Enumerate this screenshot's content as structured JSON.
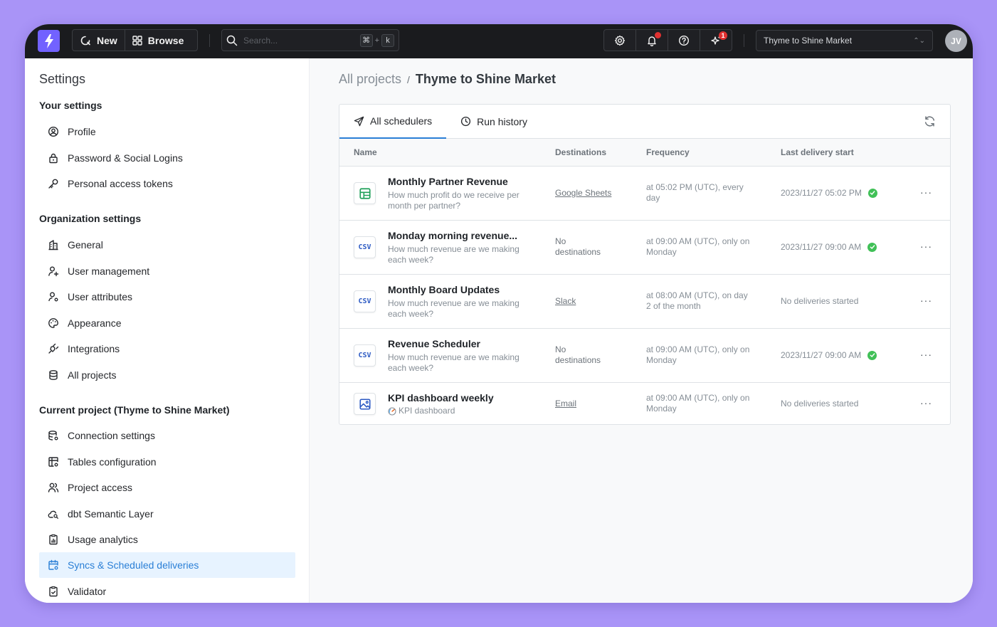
{
  "topbar": {
    "new_label": "New",
    "browse_label": "Browse",
    "search_placeholder": "Search...",
    "shortcut_cmd": "⌘",
    "shortcut_plus": "+",
    "shortcut_key": "k",
    "ai_badge": "1",
    "project_select": "Thyme to Shine Market",
    "avatar_initials": "JV"
  },
  "sidebar": {
    "title": "Settings",
    "your_settings": {
      "heading": "Your settings",
      "items": [
        {
          "label": "Profile",
          "icon": "user-circle-icon"
        },
        {
          "label": "Password & Social Logins",
          "icon": "lock-icon"
        },
        {
          "label": "Personal access tokens",
          "icon": "key-icon"
        }
      ]
    },
    "org_settings": {
      "heading": "Organization settings",
      "items": [
        {
          "label": "General",
          "icon": "building-icon"
        },
        {
          "label": "User management",
          "icon": "user-plus-icon"
        },
        {
          "label": "User attributes",
          "icon": "user-cog-icon"
        },
        {
          "label": "Appearance",
          "icon": "palette-icon"
        },
        {
          "label": "Integrations",
          "icon": "plug-icon"
        },
        {
          "label": "All projects",
          "icon": "database-icon"
        }
      ]
    },
    "project_settings": {
      "heading": "Current project (Thyme to Shine Market)",
      "items": [
        {
          "label": "Connection settings",
          "icon": "database-cog-icon"
        },
        {
          "label": "Tables configuration",
          "icon": "table-cog-icon"
        },
        {
          "label": "Project access",
          "icon": "users-icon"
        },
        {
          "label": "dbt Semantic Layer",
          "icon": "cloud-search-icon"
        },
        {
          "label": "Usage analytics",
          "icon": "clipboard-data-icon"
        },
        {
          "label": "Syncs & Scheduled deliveries",
          "icon": "calendar-cog-icon",
          "active": true
        },
        {
          "label": "Validator",
          "icon": "clipboard-check-icon"
        }
      ]
    }
  },
  "main": {
    "breadcrumb": {
      "root": "All projects",
      "sep": "/",
      "current": "Thyme to Shine Market"
    },
    "tabs": [
      {
        "label": "All schedulers",
        "active": true
      },
      {
        "label": "Run history",
        "active": false
      }
    ],
    "columns": [
      "Name",
      "Destinations",
      "Frequency",
      "Last delivery start"
    ],
    "rows": [
      {
        "type_icon": "google-sheets-icon",
        "name": "Monthly Partner Revenue",
        "desc": "How much profit do we receive per month per partner?",
        "destination": "Google Sheets",
        "destination_link": true,
        "frequency": "at 05:02 PM (UTC), every day",
        "last": "2023/11/27 05:02 PM",
        "status_ok": true
      },
      {
        "type_icon": "csv-icon",
        "type_label": "CSV",
        "name": "Monday morning revenue...",
        "desc": "How much revenue are we making each week?",
        "destination": "No destinations",
        "destination_link": false,
        "frequency": "at 09:00 AM (UTC), only on Monday",
        "last": "2023/11/27 09:00 AM",
        "status_ok": true
      },
      {
        "type_icon": "csv-icon",
        "type_label": "CSV",
        "name": "Monthly Board Updates",
        "desc": "How much revenue are we making each week?",
        "destination": "Slack",
        "destination_link": true,
        "frequency": "at 08:00 AM (UTC), on day 2 of the month",
        "last": "No deliveries started",
        "status_ok": false
      },
      {
        "type_icon": "csv-icon",
        "type_label": "CSV",
        "name": "Revenue Scheduler",
        "desc": "How much revenue are we making each week?",
        "destination": "No destinations",
        "destination_link": false,
        "frequency": "at 09:00 AM (UTC), only on Monday",
        "last": "2023/11/27 09:00 AM",
        "status_ok": true
      },
      {
        "type_icon": "image-icon",
        "name": "KPI dashboard weekly",
        "desc": "KPI dashboard",
        "desc_icon": "gauge-icon",
        "destination": "Email",
        "destination_link": true,
        "frequency": "at 09:00 AM (UTC), only on Monday",
        "last": "No deliveries started",
        "status_ok": false
      }
    ],
    "more_label": "···"
  },
  "colors": {
    "background": "#a994f7",
    "topbar": "#1a1b1e",
    "accent": "#2a7fd6",
    "logo": "#7262ff",
    "success": "#40c057",
    "alert": "#e03131"
  }
}
